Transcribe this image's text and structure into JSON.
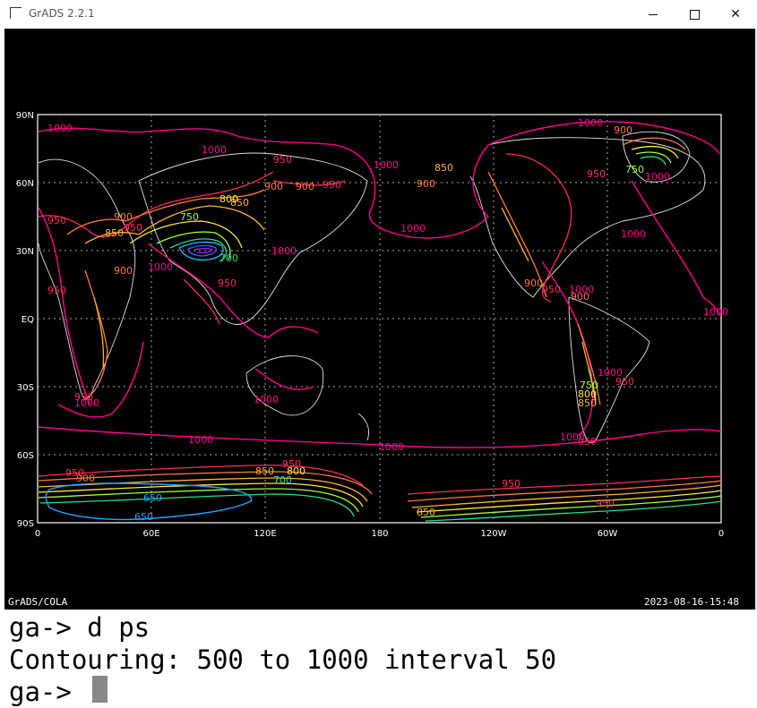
{
  "window": {
    "title": "GrADS 2.2.1",
    "controls": {
      "minimize": "minimize-icon",
      "maximize": "maximize-icon",
      "close": "close-icon"
    }
  },
  "plot": {
    "y_ticks": [
      "90N",
      "60N",
      "30N",
      "EQ",
      "30S",
      "60S",
      "90S"
    ],
    "x_ticks": [
      "0",
      "60E",
      "120E",
      "180",
      "120W",
      "60W",
      "0"
    ],
    "footer_left": "GrADS/COLA",
    "footer_right": "2023-08-16-15:48",
    "contour_labels": [
      {
        "text": "1000",
        "color": "#ff0090"
      },
      {
        "text": "950",
        "color": "#ff2a5a"
      },
      {
        "text": "900",
        "color": "#ff7a3c"
      },
      {
        "text": "850",
        "color": "#ffb030"
      },
      {
        "text": "800",
        "color": "#ffe830"
      },
      {
        "text": "750",
        "color": "#a0ff30"
      },
      {
        "text": "700",
        "color": "#20e090"
      },
      {
        "text": "650",
        "color": "#20a0ff"
      }
    ]
  },
  "console": {
    "lines": [
      "ga-> d ps",
      "Contouring: 500 to 1000 interval 50",
      "ga-> "
    ]
  }
}
